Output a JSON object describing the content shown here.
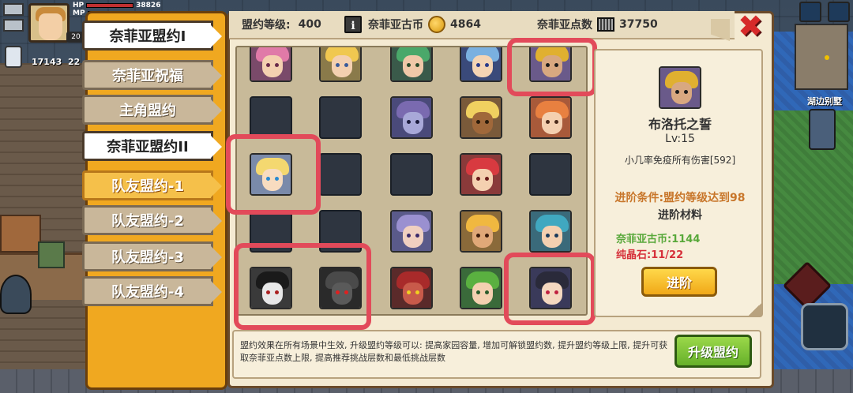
{
  "hud": {
    "hp_label": "HP",
    "mp_label": "MP",
    "hp_value": "38826",
    "level_badge": "20",
    "currency_a": "17143",
    "currency_b": "22",
    "location_label": "湖边别墅"
  },
  "tabs": [
    {
      "label": "奈菲亚盟约I",
      "state": "active"
    },
    {
      "label": "奈菲亚祝福",
      "state": "inactive"
    },
    {
      "label": "主角盟约",
      "state": "inactive"
    },
    {
      "label": "奈菲亚盟约II",
      "state": "active"
    },
    {
      "label": "队友盟约-1",
      "state": "selected"
    },
    {
      "label": "队友盟约-2",
      "state": "inactive"
    },
    {
      "label": "队友盟约-3",
      "state": "inactive"
    },
    {
      "label": "队友盟约-4",
      "state": "inactive"
    }
  ],
  "header": {
    "level_label": "盟约等级:",
    "level_value": "400",
    "info_icon": "i",
    "coin_label": "奈菲亚古币",
    "coin_value": "4864",
    "points_label": "奈菲亚点数",
    "points_value": "37750",
    "close_icon": "✖"
  },
  "grid": {
    "rows": [
      [
        "portrait:pink-hair",
        "portrait:blonde-hair",
        "portrait:green-hair",
        "portrait:blue-hair",
        "portrait:bearded-king"
      ],
      [
        "empty",
        "empty",
        "portrait:purple-elf",
        "portrait:blonde-dark",
        "portrait:orange-hair"
      ],
      [
        "portrait:blonde-girl",
        "empty",
        "empty",
        "portrait:red-hair",
        "empty"
      ],
      [
        "empty",
        "empty",
        "portrait:lavender-elf",
        "portrait:blonde-tan",
        "portrait:teal-hair"
      ],
      [
        "portrait:black-masked",
        "portrait:dark-armor",
        "portrait:red-demon",
        "portrait:green-girl",
        "portrait:dark-hair"
      ]
    ]
  },
  "detail": {
    "name": "布洛托之誓",
    "level": "Lv:15",
    "effect": "小几率免疫所有伤害[592]",
    "condition": "进阶条件:盟约等级达到98",
    "materials_title": "进阶材料",
    "material_1": "奈菲亚古币:1144",
    "material_2": "纯晶石:11/22",
    "advance_button": "进阶"
  },
  "footer": {
    "description": "盟约效果在所有场景中生效, 升级盟约等级可以: 提高家园容量, 增加可解锁盟约数, 提升盟约等级上限, 提升可获取奈菲亚点数上限, 提高推荐挑战层数和最低挑战层数",
    "upgrade_button": "升级盟约"
  },
  "colors": {
    "tab_panel": "#f0a820",
    "highlight": "#e24a5a",
    "close": "#d62a2a",
    "advance": "#f0a818",
    "upgrade": "#66b02a"
  }
}
